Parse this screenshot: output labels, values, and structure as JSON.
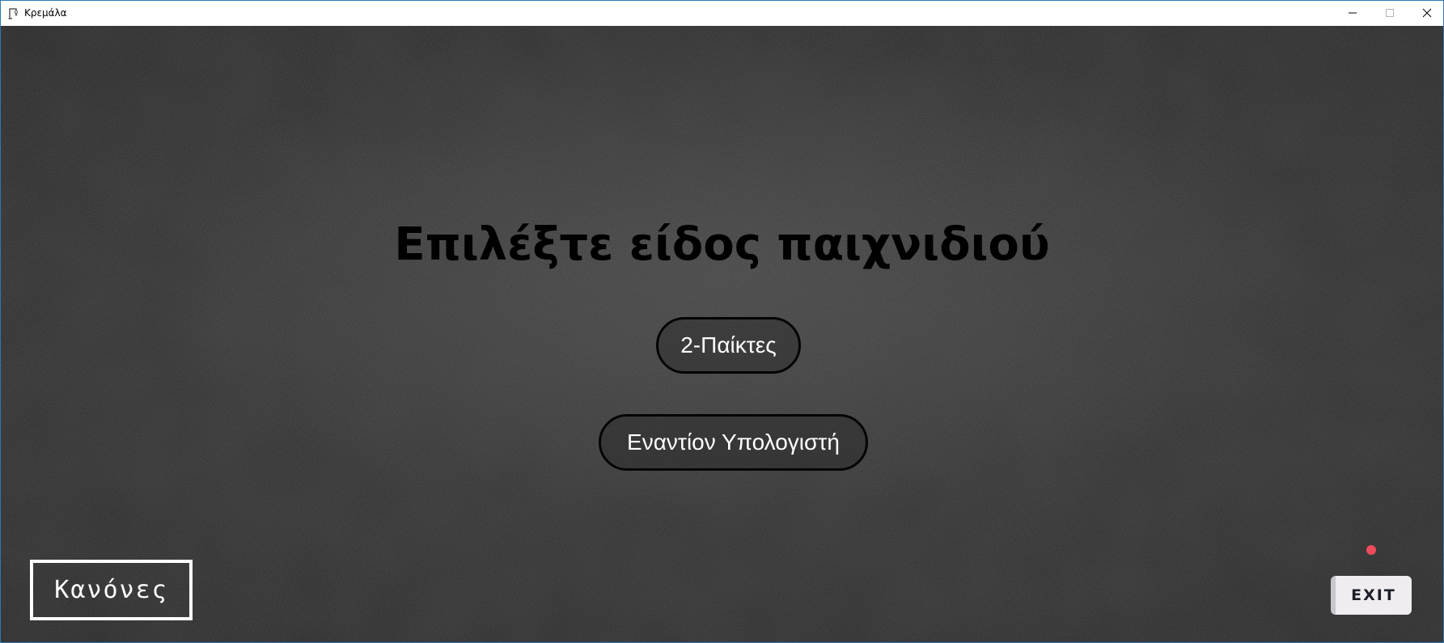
{
  "window": {
    "title": "Κρεμάλα",
    "app_icon": "gallows-icon",
    "controls": {
      "minimize_icon": "minimize-icon",
      "maximize_icon": "maximize-icon",
      "close_icon": "close-icon"
    }
  },
  "game": {
    "heading": "Επιλέξτε είδος παιχνιδιού",
    "mode_buttons": [
      {
        "label": "2-Παίκτες"
      },
      {
        "label": "Εναντίον Υπολογιστή"
      }
    ],
    "rules_button": "Κανόνες",
    "exit_button": "EXIT"
  },
  "colors": {
    "background": "#262626",
    "heading": "#000000",
    "button_text": "#ffffff",
    "exit_bg": "#efedf0",
    "exit_dot": "#ee4b5a",
    "window_border": "#2b79b5"
  }
}
